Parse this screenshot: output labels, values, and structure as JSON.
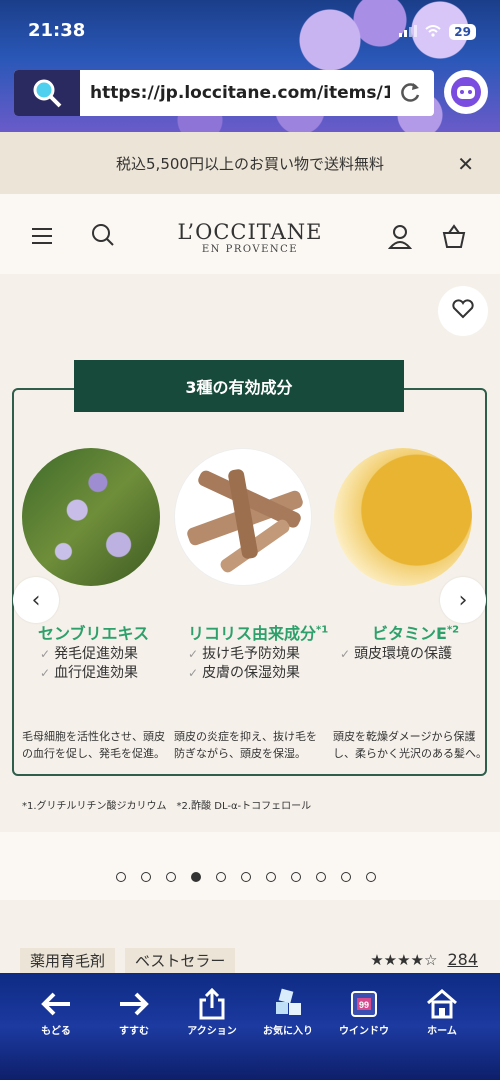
{
  "status": {
    "time": "21:38",
    "battery": "29"
  },
  "browser": {
    "url": "https://jp.loccitane.com/items/11..."
  },
  "banner": {
    "text": "税込5,500円以上のお買い物で送料無料",
    "close": "✕"
  },
  "logo": {
    "main": "L’OCCITANE",
    "sub": "EN PROVENCE"
  },
  "section": {
    "title": "3種の有効成分"
  },
  "ingredients": [
    {
      "name": "センブリエキス",
      "sup": "",
      "benefits": [
        "発毛促進効果",
        "血行促進効果"
      ],
      "desc": [
        "毛母細胞を活性化させ、頭皮",
        "の血行を促し、発毛を促進。"
      ]
    },
    {
      "name": "リコリス由来成分",
      "sup": "*1",
      "benefits": [
        "抜け毛予防効果",
        "皮膚の保湿効果"
      ],
      "desc": [
        "頭皮の炎症を抑え、抜け毛を",
        "防ぎながら、頭皮を保湿。"
      ]
    },
    {
      "name": "ビタミンE",
      "sup": "*2",
      "benefits": [
        "頭皮環境の保護"
      ],
      "desc": [
        "頭皮を乾燥ダメージから保護",
        "し、柔らかく光沢のある髪へ。"
      ]
    }
  ],
  "footnote": "*1.グリチルリチン酸ジカリウム　*2.酢酸 DL-α-トコフェロール",
  "carousel": {
    "count": 11,
    "active": 3
  },
  "tags": [
    "薬用育毛剤",
    "ベストセラー"
  ],
  "rating": {
    "value": 4.5,
    "stars": "★★★★☆",
    "count": "284"
  },
  "toolbar": [
    {
      "label": "もどる",
      "icon": "back-arrow-icon"
    },
    {
      "label": "すすむ",
      "icon": "forward-arrow-icon"
    },
    {
      "label": "アクション",
      "icon": "share-icon"
    },
    {
      "label": "お気に入り",
      "icon": "bookmarks-icon"
    },
    {
      "label": "ウインドウ",
      "icon": "windows-icon",
      "badge": "99"
    },
    {
      "label": "ホーム",
      "icon": "home-icon"
    }
  ],
  "colors": {
    "accent_green": "#2ea06b",
    "title_bg": "#174a3a",
    "toolbar_bg": "#1c3aa0"
  }
}
